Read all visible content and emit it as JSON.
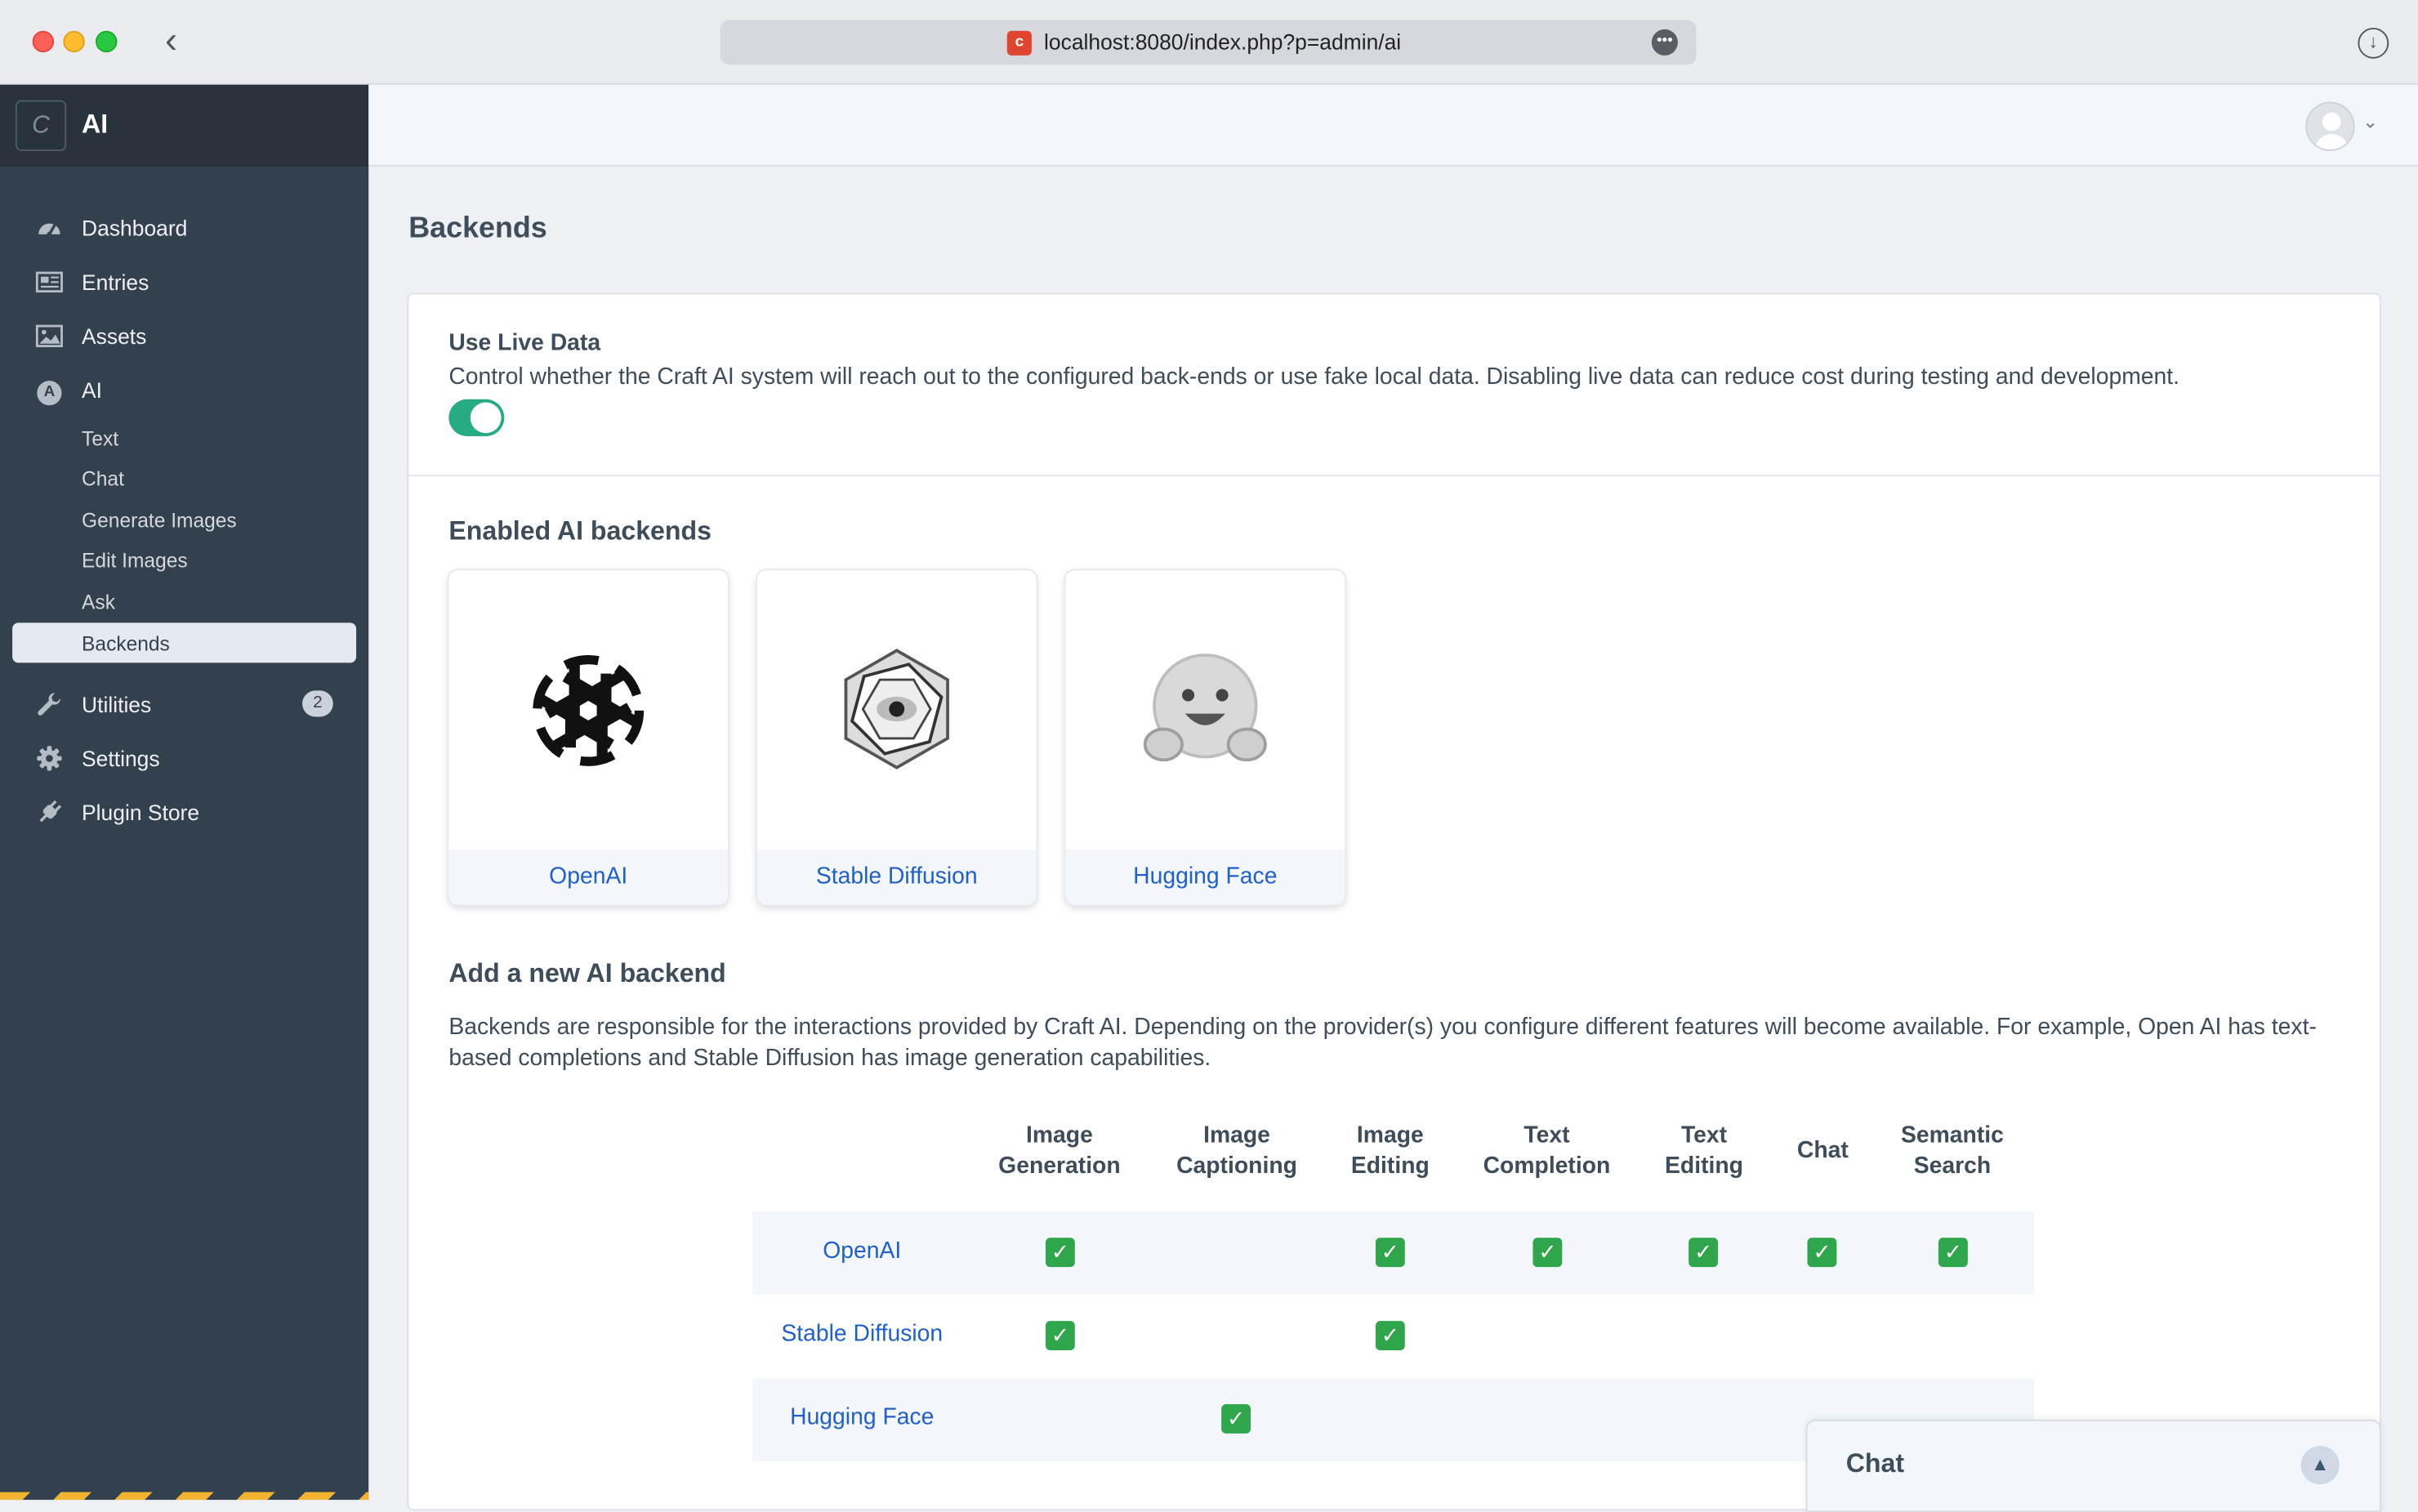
{
  "browser": {
    "url": "localhost:8080/index.php?p=admin/ai",
    "favicon_letter": "c"
  },
  "sidebar": {
    "logo_letter": "C",
    "site_name": "AI",
    "items": [
      {
        "label": "Dashboard",
        "icon": "gauge-icon"
      },
      {
        "label": "Entries",
        "icon": "newspaper-icon"
      },
      {
        "label": "Assets",
        "icon": "image-icon"
      },
      {
        "label": "AI",
        "icon": "ai-circle-icon",
        "icon_letter": "A"
      },
      {
        "label": "Text"
      },
      {
        "label": "Chat"
      },
      {
        "label": "Generate Images"
      },
      {
        "label": "Edit Images"
      },
      {
        "label": "Ask"
      },
      {
        "label": "Backends",
        "active": true
      },
      {
        "label": "Utilities",
        "icon": "wrench-icon",
        "badge": "2"
      },
      {
        "label": "Settings",
        "icon": "gear-icon"
      },
      {
        "label": "Plugin Store",
        "icon": "plug-icon"
      }
    ]
  },
  "main": {
    "title": "Backends",
    "live_data": {
      "title": "Use Live Data",
      "description": "Control whether the Craft AI system will reach out to the configured back-ends or use fake local data. Disabling live data can reduce cost during testing and development.",
      "enabled": true
    },
    "enabled_title": "Enabled AI backends",
    "enabled_backends": [
      {
        "name": "OpenAI",
        "logo": "openai-logo-icon"
      },
      {
        "name": "Stable Diffusion",
        "logo": "stable-diffusion-logo-icon"
      },
      {
        "name": "Hugging Face",
        "logo": "hugging-face-logo-icon"
      }
    ],
    "add_title": "Add a new AI backend",
    "add_description": "Backends are responsible for the interactions provided by Craft AI. Depending on the provider(s) you configure different features will become available. For example, Open AI has text-based completions and Stable Diffusion has image generation capabilities.",
    "table": {
      "columns": [
        "Image Generation",
        "Image Captioning",
        "Image Editing",
        "Text Completion",
        "Text Editing",
        "Chat",
        "Semantic Search"
      ],
      "column_lines": [
        [
          "Image",
          "Generation"
        ],
        [
          "Image",
          "Captioning"
        ],
        [
          "Image",
          "Editing"
        ],
        [
          "Text",
          "Completion"
        ],
        [
          "Text",
          "Editing"
        ],
        [
          "Chat",
          ""
        ],
        [
          "Semantic",
          "Search"
        ]
      ],
      "rows": [
        {
          "name": "OpenAI",
          "features": [
            true,
            false,
            true,
            true,
            true,
            true,
            true
          ]
        },
        {
          "name": "Stable Diffusion",
          "features": [
            true,
            false,
            true,
            false,
            false,
            false,
            false
          ]
        },
        {
          "name": "Hugging Face",
          "features": [
            false,
            true,
            false,
            false,
            false,
            false,
            false
          ]
        }
      ],
      "check_glyph": "✓"
    }
  },
  "chat_widget": {
    "title": "Chat"
  },
  "colors": {
    "sidebar_bg": "#33404d",
    "accent_link": "#1f5fcf",
    "toggle_on": "#27ab83",
    "check_green": "#2fa64b",
    "hazard_stripe": "#f1b431"
  }
}
